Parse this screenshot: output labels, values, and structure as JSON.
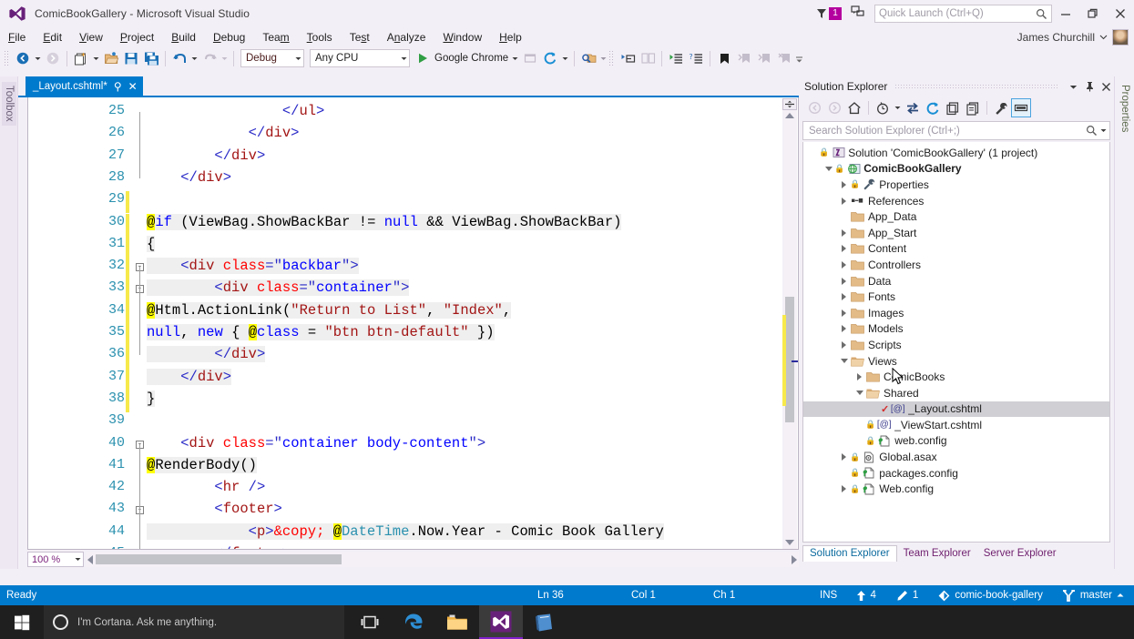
{
  "window": {
    "title": "ComicBookGallery - Microsoft Visual Studio",
    "logo_icon": "visual-studio-logo",
    "minimize_label": "—",
    "maximize_label": "❐",
    "close_label": "✕"
  },
  "titlebar_right": {
    "notification_icon": "funnel-icon",
    "notification_count": "1",
    "feedback_icon": "feedback-icon",
    "search_icon": "magnifier-icon"
  },
  "quick_launch": {
    "placeholder": "Quick Launch (Ctrl+Q)",
    "value": ""
  },
  "account": {
    "name": "James Churchill",
    "dropdown_icon": "chevron-down-icon",
    "avatar_icon": "user-avatar"
  },
  "menu": {
    "items": [
      {
        "label": "File",
        "accel": "F"
      },
      {
        "label": "Edit",
        "accel": "E"
      },
      {
        "label": "View",
        "accel": "V"
      },
      {
        "label": "Project",
        "accel": "P"
      },
      {
        "label": "Build",
        "accel": "B"
      },
      {
        "label": "Debug",
        "accel": "D"
      },
      {
        "label": "Team",
        "accel": "m"
      },
      {
        "label": "Tools",
        "accel": "T"
      },
      {
        "label": "Test",
        "accel": "s"
      },
      {
        "label": "Analyze",
        "accel": "n"
      },
      {
        "label": "Window",
        "accel": "W"
      },
      {
        "label": "Help",
        "accel": "H"
      }
    ]
  },
  "toolbar": {
    "navigate_back_icon": "navigate-back-icon",
    "navigate_forward_icon": "navigate-forward-icon",
    "new_project_icon": "new-project-icon",
    "open_file_icon": "open-file-icon",
    "save_icon": "save-icon",
    "save_all_icon": "save-all-icon",
    "undo_icon": "undo-icon",
    "redo_icon": "redo-icon",
    "config_value": "Debug",
    "platform_value": "Any CPU",
    "start_icon": "play-icon",
    "start_label": "Google Chrome",
    "browser_select_icon": "browser-select-icon",
    "refresh_icon": "refresh-linked-icon",
    "find_icon": "find-in-files-icon",
    "step_icon": "step-icon",
    "comment_icon": "comment-icon",
    "uncomment_icon": "uncomment-icon",
    "indent_icon": "increase-indent-icon",
    "outdent_icon": "decrease-indent-icon",
    "bookmark_icon": "bookmark-icon",
    "bookmark_prev_icon": "bookmark-prev-icon",
    "bookmark_next_icon": "bookmark-next-icon",
    "bookmark_clear_icon": "bookmark-clear-icon",
    "overflow_icon": "toolbar-overflow-icon"
  },
  "left_dock": {
    "toolbox_label": "Toolbox"
  },
  "right_dock": {
    "properties_label": "Properties"
  },
  "editor": {
    "tab_label": "_Layout.cshtml*",
    "pin_icon": "pin-icon",
    "close_icon": "close-icon",
    "zoom_value": "100 %",
    "zoom_dropdown_icon": "chevron-down-icon",
    "first_line": 25,
    "lines": [
      {
        "n": 25,
        "indent": 0,
        "changed": false,
        "fold": null,
        "tokens": [
          {
            "t": "                ",
            "c": "k-txt"
          },
          {
            "t": "</ul>",
            "c": "k-tag-wrap"
          }
        ]
      },
      {
        "n": 26,
        "indent": 0,
        "changed": false,
        "fold": null,
        "tokens": [
          {
            "t": "            ",
            "c": "k-txt"
          },
          {
            "t": "</div>",
            "c": "k-tag-wrap"
          }
        ]
      },
      {
        "n": 27,
        "indent": 0,
        "changed": false,
        "fold": null,
        "tokens": [
          {
            "t": "        ",
            "c": "k-txt"
          },
          {
            "t": "</div>",
            "c": "k-tag-wrap"
          }
        ]
      },
      {
        "n": 28,
        "indent": 0,
        "changed": false,
        "fold": null,
        "tokens": [
          {
            "t": "    ",
            "c": "k-txt"
          },
          {
            "t": "</div>",
            "c": "k-tag-wrap"
          }
        ]
      },
      {
        "n": 29,
        "indent": 0,
        "changed": true,
        "fold": null,
        "tokens": []
      },
      {
        "n": 30,
        "indent": 0,
        "changed": true,
        "fold": null,
        "text": "@if (ViewBag.ShowBackBar != null && ViewBag.ShowBackBar)"
      },
      {
        "n": 31,
        "indent": 0,
        "changed": true,
        "fold": null,
        "text": "{"
      },
      {
        "n": 32,
        "indent": 0,
        "changed": true,
        "fold": "collapse",
        "text": "    <div class=\"backbar\">"
      },
      {
        "n": 33,
        "indent": 0,
        "changed": true,
        "fold": "collapse",
        "text": "        <div class=\"container\">"
      },
      {
        "n": 34,
        "indent": 0,
        "changed": true,
        "fold": null,
        "text": "            @Html.ActionLink(\"Return to List\", \"Index\","
      },
      {
        "n": 35,
        "indent": 0,
        "changed": true,
        "fold": null,
        "text": "                null, new { @class = \"btn btn-default\" })"
      },
      {
        "n": 36,
        "indent": 0,
        "changed": true,
        "fold": null,
        "cursor": true,
        "text": "        </div>"
      },
      {
        "n": 37,
        "indent": 0,
        "changed": true,
        "fold": null,
        "text": "    </div>"
      },
      {
        "n": 38,
        "indent": 0,
        "changed": true,
        "fold": null,
        "text": "}"
      },
      {
        "n": 39,
        "indent": 0,
        "changed": false,
        "fold": null,
        "text": ""
      },
      {
        "n": 40,
        "indent": 0,
        "changed": false,
        "fold": "collapse",
        "text": "    <div class=\"container body-content\">"
      },
      {
        "n": 41,
        "indent": 0,
        "changed": false,
        "fold": null,
        "text": "        @RenderBody()"
      },
      {
        "n": 42,
        "indent": 0,
        "changed": false,
        "fold": null,
        "text": "        <hr />"
      },
      {
        "n": 43,
        "indent": 0,
        "changed": false,
        "fold": "collapse",
        "text": "        <footer>"
      },
      {
        "n": 44,
        "indent": 0,
        "changed": false,
        "fold": null,
        "text": "            <p>&copy; @DateTime.Now.Year - Comic Book Gallery"
      },
      {
        "n": 45,
        "indent": 0,
        "changed": false,
        "fold": null,
        "text": "        </footer>"
      }
    ]
  },
  "solution_explorer": {
    "title": "Solution Explorer",
    "dropdown_icon": "chevron-down-icon",
    "pin_icon": "pin-icon",
    "close_icon": "close-icon",
    "toolbar_icons": [
      "back-icon",
      "forward-icon",
      "home-icon",
      "pending-changes-icon",
      "sync-with-active-document-icon",
      "refresh-icon",
      "collapse-all-icon",
      "show-all-files-icon",
      "properties-icon",
      "preview-selected-items-icon"
    ],
    "search_placeholder": "Search Solution Explorer (Ctrl+;)",
    "search_value": "",
    "search_icon": "magnifier-icon",
    "tree": [
      {
        "depth": 0,
        "label": "Solution 'ComicBookGallery' (1 project)",
        "icon": "solution-icon",
        "expander": "none",
        "bold": false,
        "lock": true
      },
      {
        "depth": 1,
        "label": "ComicBookGallery",
        "icon": "web-project-icon",
        "expander": "down",
        "bold": true,
        "lock": true
      },
      {
        "depth": 2,
        "label": "Properties",
        "icon": "wrench-icon",
        "expander": "right",
        "bold": false,
        "lock": true
      },
      {
        "depth": 2,
        "label": "References",
        "icon": "references-icon",
        "expander": "right",
        "bold": false,
        "lock": false
      },
      {
        "depth": 2,
        "label": "App_Data",
        "icon": "folder-icon",
        "expander": "none",
        "bold": false,
        "lock": false
      },
      {
        "depth": 2,
        "label": "App_Start",
        "icon": "folder-icon",
        "expander": "right",
        "bold": false,
        "lock": false
      },
      {
        "depth": 2,
        "label": "Content",
        "icon": "folder-icon",
        "expander": "right",
        "bold": false,
        "lock": false
      },
      {
        "depth": 2,
        "label": "Controllers",
        "icon": "folder-icon",
        "expander": "right",
        "bold": false,
        "lock": false
      },
      {
        "depth": 2,
        "label": "Data",
        "icon": "folder-icon",
        "expander": "right",
        "bold": false,
        "lock": false
      },
      {
        "depth": 2,
        "label": "Fonts",
        "icon": "folder-icon",
        "expander": "right",
        "bold": false,
        "lock": false
      },
      {
        "depth": 2,
        "label": "Images",
        "icon": "folder-icon",
        "expander": "right",
        "bold": false,
        "lock": false
      },
      {
        "depth": 2,
        "label": "Models",
        "icon": "folder-icon",
        "expander": "right",
        "bold": false,
        "lock": false
      },
      {
        "depth": 2,
        "label": "Scripts",
        "icon": "folder-icon",
        "expander": "right",
        "bold": false,
        "lock": false
      },
      {
        "depth": 2,
        "label": "Views",
        "icon": "folder-open-icon",
        "expander": "down",
        "bold": false,
        "lock": false
      },
      {
        "depth": 3,
        "label": "ComicBooks",
        "icon": "folder-icon",
        "expander": "right",
        "bold": false,
        "lock": false
      },
      {
        "depth": 3,
        "label": "Shared",
        "icon": "folder-open-icon",
        "expander": "down",
        "bold": false,
        "lock": false
      },
      {
        "depth": 4,
        "label": "_Layout.cshtml",
        "icon": "razor-view-icon",
        "expander": "none",
        "bold": false,
        "lock": false,
        "check": true,
        "selected": true
      },
      {
        "depth": 3,
        "label": "_ViewStart.cshtml",
        "icon": "razor-view-icon",
        "expander": "none",
        "bold": false,
        "lock": true
      },
      {
        "depth": 3,
        "label": "web.config",
        "icon": "config-icon",
        "expander": "none",
        "bold": false,
        "lock": true
      },
      {
        "depth": 2,
        "label": "Global.asax",
        "icon": "asax-icon",
        "expander": "right",
        "bold": false,
        "lock": true
      },
      {
        "depth": 2,
        "label": "packages.config",
        "icon": "config-icon",
        "expander": "none",
        "bold": false,
        "lock": true
      },
      {
        "depth": 2,
        "label": "Web.config",
        "icon": "config-icon",
        "expander": "right",
        "bold": false,
        "lock": true
      }
    ],
    "tabs": [
      {
        "label": "Solution Explorer",
        "active": true
      },
      {
        "label": "Team Explorer",
        "active": false
      },
      {
        "label": "Server Explorer",
        "active": false
      }
    ]
  },
  "statusbar": {
    "ready": "Ready",
    "line": "Ln 36",
    "col": "Col 1",
    "ch": "Ch 1",
    "ins": "INS",
    "pending_changes_icon": "up-arrow-icon",
    "pending_changes_count": "4",
    "edits_icon": "pencil-icon",
    "edits_count": "1",
    "repo_icon": "git-repo-icon",
    "repo_name": "comic-book-gallery",
    "branch_icon": "branch-icon",
    "branch_name": "master",
    "branch_dropdown_icon": "chevron-up-icon"
  },
  "taskbar": {
    "start_icon": "windows-start-icon",
    "cortana_icon": "cortana-ring-icon",
    "cortana_placeholder": "I'm Cortana. Ask me anything.",
    "apps": [
      {
        "name": "task-view-icon",
        "active": false
      },
      {
        "name": "edge-icon",
        "active": false
      },
      {
        "name": "file-explorer-icon",
        "active": false
      },
      {
        "name": "visual-studio-icon",
        "active": true
      },
      {
        "name": "blue-book-icon",
        "active": false
      }
    ]
  },
  "colors": {
    "accent": "#007acc",
    "chrome": "#f3eff6",
    "badge": "#b4009e",
    "changebar": "#f7e94b"
  }
}
